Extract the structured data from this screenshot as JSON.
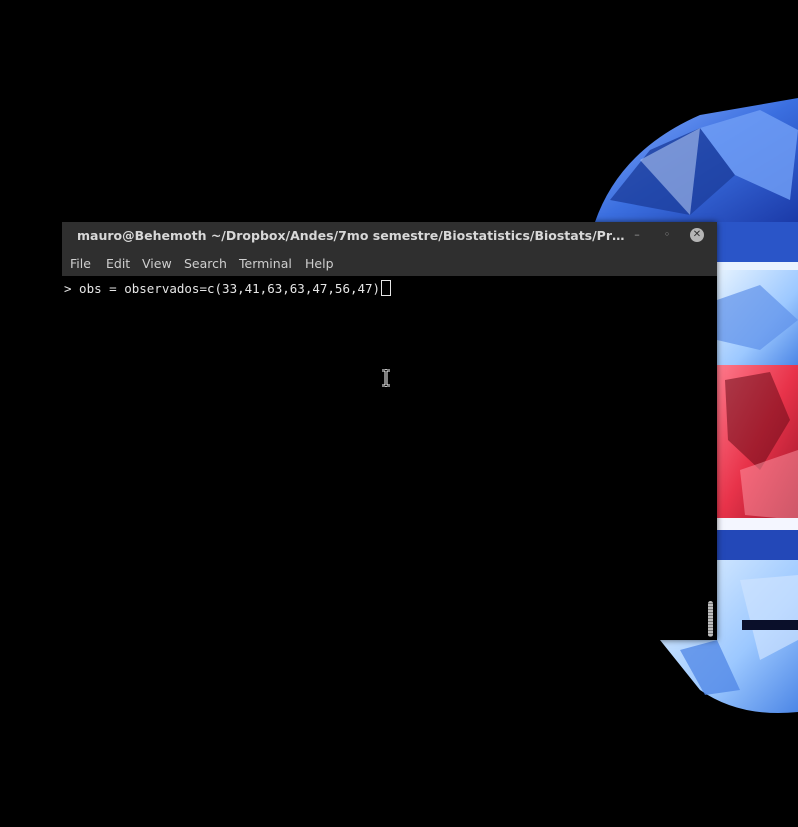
{
  "window": {
    "title": "mauro@Behemoth ~/Dropbox/Andes/7mo semestre/Biostatistics/Biostats/Prese...",
    "controls": {
      "minimize_glyph": "–",
      "maximize_glyph": "◦",
      "close_glyph": "✕"
    }
  },
  "menubar": {
    "items": [
      {
        "label": "File"
      },
      {
        "label": "Edit"
      },
      {
        "label": "View"
      },
      {
        "label": "Search"
      },
      {
        "label": "Terminal"
      },
      {
        "label": "Help"
      }
    ]
  },
  "terminal": {
    "prompt_line": "> obs = observados=c(33,41,63,63,47,56,47)"
  },
  "icons": {
    "mouse_pointer": "text-ibeam-cursor-icon",
    "close": "close-icon",
    "minimize": "minimize-icon",
    "maximize": "maximize-icon"
  },
  "colors": {
    "titlebar": "#2f2f2f",
    "terminal_bg": "#000000",
    "terminal_fg": "#e6e6e6",
    "wallpaper_blue": "#3b6fe0",
    "wallpaper_red": "#e8334a"
  }
}
